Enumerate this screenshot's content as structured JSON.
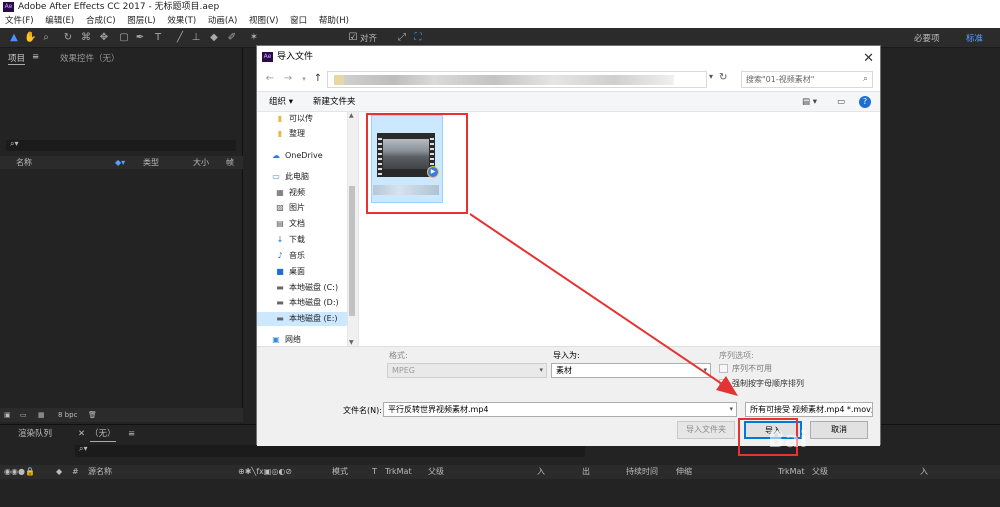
{
  "app": {
    "title": "Adobe After Effects CC 2017 - 无标题项目.aep",
    "logo_text": "Ae",
    "menu": [
      "文件(F)",
      "编辑(E)",
      "合成(C)",
      "图层(L)",
      "效果(T)",
      "动画(A)",
      "视图(V)",
      "窗口",
      "帮助(H)"
    ],
    "toolbar": {
      "snap_label": "对齐",
      "workspace_default": "必要项",
      "workspace_standard": "标准"
    },
    "panels": {
      "project_tab": "项目",
      "effects_tab": "效果控件（无）",
      "col_name": "名称",
      "col_type": "类型",
      "col_size": "大小",
      "col_fr": "帧",
      "bpc": "8 bpc",
      "render_queue_tab": "渲染队列",
      "comp_tab": "（无）",
      "tl_source": "源名称",
      "tl_mode": "模式",
      "tl_t": "T",
      "tl_trkmat": "TrkMat",
      "tl_parent": "父级",
      "tl_in": "入",
      "tl_out": "出",
      "tl_duration": "持续时间",
      "tl_stretch": "伸缩",
      "tl_trkmat2": "TrkMat",
      "tl_parent2": "父级",
      "tl_in2": "入"
    }
  },
  "dialog": {
    "title": "导入文件",
    "logo_text": "Ae",
    "close_glyph": "✕",
    "search_placeholder": "搜索\"01-视频素材\"",
    "organize_label": "组织 ▾",
    "new_folder_label": "新建文件夹",
    "nav_items": [
      {
        "label": "可以传",
        "icon": "folder-icon"
      },
      {
        "label": "整理",
        "icon": "folder-icon"
      },
      {
        "label": "OneDrive",
        "icon": "cloud-icon"
      },
      {
        "label": "此电脑",
        "icon": "computer-icon"
      },
      {
        "label": "视频",
        "icon": "video-icon"
      },
      {
        "label": "图片",
        "icon": "picture-icon"
      },
      {
        "label": "文档",
        "icon": "document-icon"
      },
      {
        "label": "下载",
        "icon": "download-icon"
      },
      {
        "label": "音乐",
        "icon": "music-icon"
      },
      {
        "label": "桌面",
        "icon": "desktop-icon"
      },
      {
        "label": "本地磁盘 (C:)",
        "icon": "drive-icon"
      },
      {
        "label": "本地磁盘 (D:)",
        "icon": "drive-icon"
      },
      {
        "label": "本地磁盘 (E:)",
        "icon": "drive-icon"
      },
      {
        "label": "网络",
        "icon": "network-icon"
      }
    ],
    "format_label": "格式:",
    "format_value": "MPEG",
    "import_as_label": "导入为:",
    "import_as_value": "素材",
    "sequence_label": "序列选项:",
    "sequence_unavailable": "序列不可用",
    "force_alpha_label": "强制按字母顺序排列",
    "filename_label": "文件名(N):",
    "filename_value": "平行反转世界视频素材.mp4",
    "filetype_value": "所有可接受的文件 (*.mp4;*.mov;...)",
    "filetype_overlay": "视频素材.mp4",
    "import_folder_label": "导入文件夹",
    "open_label": "导入",
    "cancel_label": "取消"
  },
  "watermark": "Bai"
}
